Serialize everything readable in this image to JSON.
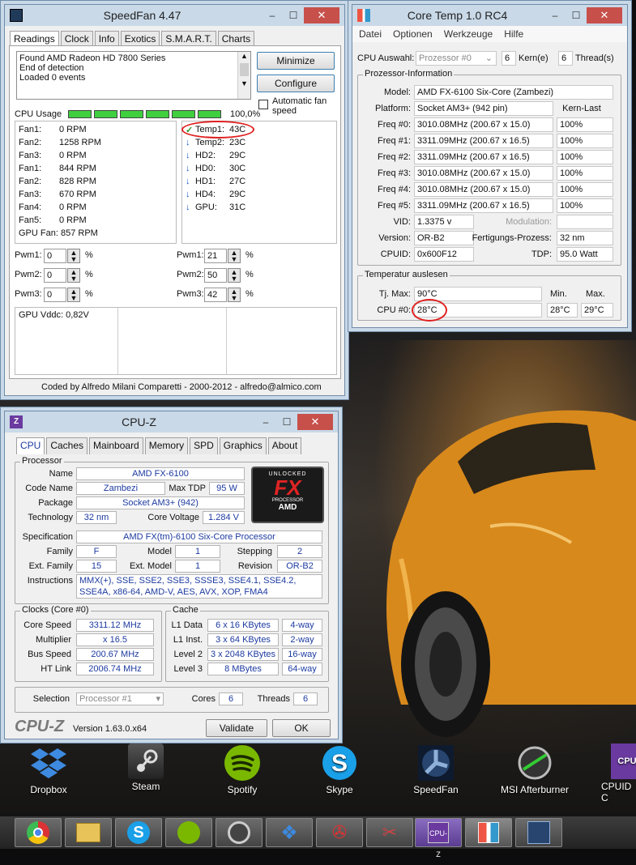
{
  "speedfan": {
    "title": "SpeedFan 4.47",
    "tabs": [
      "Readings",
      "Clock",
      "Info",
      "Exotics",
      "S.M.A.R.T.",
      "Charts"
    ],
    "log": [
      "Found AMD Radeon HD 7800 Series",
      "End of detection",
      "Loaded 0 events"
    ],
    "minimize": "Minimize",
    "configure": "Configure",
    "autofan": "Automatic fan speed",
    "cpu_usage_label": "CPU Usage",
    "cpu_usage_value": "100,0%",
    "fans": [
      [
        "Fan1:",
        "0 RPM"
      ],
      [
        "Fan2:",
        "1258 RPM"
      ],
      [
        "Fan3:",
        "0 RPM"
      ],
      [
        "Fan1:",
        "844 RPM"
      ],
      [
        "Fan2:",
        "828 RPM"
      ],
      [
        "Fan3:",
        "670 RPM"
      ],
      [
        "Fan4:",
        "0 RPM"
      ],
      [
        "Fan5:",
        "0 RPM"
      ]
    ],
    "gpu_fan": "GPU Fan: 857 RPM",
    "temps": [
      [
        "✓",
        "Temp1:",
        "43C"
      ],
      [
        "↓",
        "Temp2:",
        "23C"
      ],
      [
        "↓",
        "HD2:",
        "29C"
      ],
      [
        "↓",
        "HD0:",
        "30C"
      ],
      [
        "↓",
        "HD1:",
        "27C"
      ],
      [
        "↓",
        "HD4:",
        "29C"
      ],
      [
        "↓",
        "GPU:",
        "31C"
      ]
    ],
    "pwm_left": [
      [
        "Pwm1:",
        "0"
      ],
      [
        "Pwm2:",
        "0"
      ],
      [
        "Pwm3:",
        "0"
      ]
    ],
    "pwm_right": [
      [
        "Pwm1:",
        "21"
      ],
      [
        "Pwm2:",
        "50"
      ],
      [
        "Pwm3:",
        "42"
      ]
    ],
    "pct": "%",
    "gpu_vddc": "GPU Vddc:  0,82V",
    "footer": "Coded by Alfredo Milani Comparetti - 2000-2012 - alfredo@almico.com"
  },
  "coretemp": {
    "title": "Core Temp 1.0 RC4",
    "menu": [
      "Datei",
      "Optionen",
      "Werkzeuge",
      "Hilfe"
    ],
    "cpu_select_label": "CPU Auswahl:",
    "cpu_select": "Prozessor #0",
    "kern_n": "6",
    "kern_l": "Kern(e)",
    "thr_n": "6",
    "thr_l": "Thread(s)",
    "info_group": "Prozessor-Information",
    "model_l": "Model:",
    "model": "AMD FX-6100 Six-Core (Zambezi)",
    "platform_l": "Platform:",
    "platform": "Socket AM3+ (942 pin)",
    "kernlast": "Kern-Last",
    "freqs": [
      [
        "Freq #0:",
        "3010.08MHz (200.67 x 15.0)",
        "100%"
      ],
      [
        "Freq #1:",
        "3311.09MHz (200.67 x 16.5)",
        "100%"
      ],
      [
        "Freq #2:",
        "3311.09MHz (200.67 x 16.5)",
        "100%"
      ],
      [
        "Freq #3:",
        "3010.08MHz (200.67 x 15.0)",
        "100%"
      ],
      [
        "Freq #4:",
        "3010.08MHz (200.67 x 15.0)",
        "100%"
      ],
      [
        "Freq #5:",
        "3311.09MHz (200.67 x 16.5)",
        "100%"
      ]
    ],
    "vid_l": "VID:",
    "vid": "1.3375 v",
    "mod_l": "Modulation:",
    "version_l": "Version:",
    "version": "OR-B2",
    "fp_l": "Fertigungs-Prozess:",
    "fp": "32 nm",
    "cpuid_l": "CPUID:",
    "cpuid": "0x600F12",
    "tdp_l": "TDP:",
    "tdp": "95.0 Watt",
    "temp_group": "Temperatur auslesen",
    "tj_l": "Tj. Max:",
    "tj": "90°C",
    "min_l": "Min.",
    "max_l": "Max.",
    "cpu0_l": "CPU #0:",
    "cpu0": "28°C",
    "cpu0_min": "28°C",
    "cpu0_max": "29°C"
  },
  "cpuz": {
    "title": "CPU-Z",
    "tabs": [
      "CPU",
      "Caches",
      "Mainboard",
      "Memory",
      "SPD",
      "Graphics",
      "About"
    ],
    "proc_group": "Processor",
    "name_l": "Name",
    "name": "AMD FX-6100",
    "code_l": "Code Name",
    "code": "Zambezi",
    "tdp_l": "Max TDP",
    "tdp": "95 W",
    "pkg_l": "Package",
    "pkg": "Socket AM3+ (942)",
    "tech_l": "Technology",
    "tech": "32 nm",
    "cv_l": "Core Voltage",
    "cv": "1.284 V",
    "spec_l": "Specification",
    "spec": "AMD FX(tm)-6100 Six-Core Processor",
    "fam_l": "Family",
    "fam": "F",
    "model_l": "Model",
    "model": "1",
    "step_l": "Stepping",
    "step": "2",
    "efam_l": "Ext. Family",
    "efam": "15",
    "emod_l": "Ext. Model",
    "emod": "1",
    "rev_l": "Revision",
    "rev": "OR-B2",
    "instr_l": "Instructions",
    "instr": "MMX(+), SSE, SSE2, SSE3, SSSE3, SSE4.1, SSE4.2, SSE4A, x86-64, AMD-V, AES, AVX, XOP, FMA4",
    "clocks_group": "Clocks (Core #0)",
    "cs_l": "Core Speed",
    "cs": "3311.12 MHz",
    "mul_l": "Multiplier",
    "mul": "x 16.5",
    "bus_l": "Bus Speed",
    "bus": "200.67 MHz",
    "ht_l": "HT Link",
    "ht": "2006.74 MHz",
    "cache_group": "Cache",
    "caches": [
      [
        "L1 Data",
        "6 x 16 KBytes",
        "4-way"
      ],
      [
        "L1 Inst.",
        "3 x 64 KBytes",
        "2-way"
      ],
      [
        "Level 2",
        "3 x 2048 KBytes",
        "16-way"
      ],
      [
        "Level 3",
        "8 MBytes",
        "64-way"
      ]
    ],
    "sel_l": "Selection",
    "sel": "Processor #1",
    "cores_l": "Cores",
    "cores": "6",
    "threads_l": "Threads",
    "threads": "6",
    "logo": "CPU-Z",
    "ver": "Version 1.63.0.x64",
    "validate": "Validate",
    "ok": "OK",
    "badge_top": "UNLOCKED",
    "badge_mid": "FX",
    "badge_proc": "PROCESSOR",
    "badge_amd": "AMD"
  },
  "desktop": [
    {
      "label": "Dropbox",
      "icon": "dropbox-icon"
    },
    {
      "label": "Steam",
      "icon": "steam-icon"
    },
    {
      "label": "Spotify",
      "icon": "spotify-icon"
    },
    {
      "label": "Skype",
      "icon": "skype-icon"
    },
    {
      "label": "SpeedFan",
      "icon": "speedfan-icon"
    },
    {
      "label": "MSI Afterburner",
      "icon": "afterburner-icon"
    },
    {
      "label": "CPUID C",
      "icon": "cpuid-icon"
    }
  ],
  "taskbar": [
    "chrome-icon",
    "explorer-icon",
    "skype-icon",
    "spotify-icon",
    "steam-icon",
    "dropbox-icon",
    "app-icon",
    "tool-icon",
    "cpuz-icon",
    "coretemp-icon",
    "speedfan-icon"
  ]
}
